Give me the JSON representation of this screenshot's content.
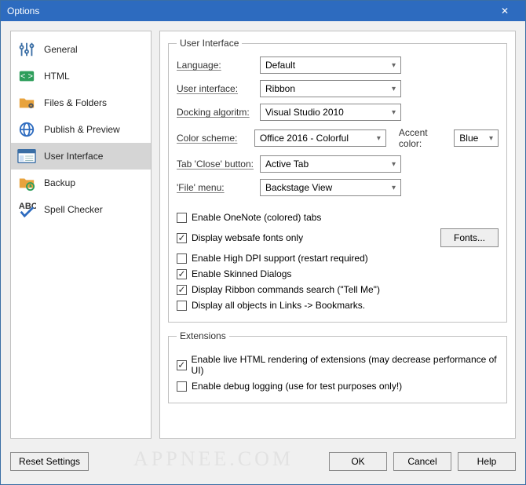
{
  "window": {
    "title": "Options",
    "close_glyph": "✕"
  },
  "sidebar": {
    "items": [
      {
        "label": "General"
      },
      {
        "label": "HTML"
      },
      {
        "label": "Files & Folders"
      },
      {
        "label": "Publish & Preview"
      },
      {
        "label": "User Interface"
      },
      {
        "label": "Backup"
      },
      {
        "label": "Spell Checker"
      }
    ]
  },
  "group_ui": {
    "legend": "User Interface",
    "rows": {
      "language": {
        "label": "Language:",
        "value": "Default"
      },
      "userinterface": {
        "label": "User interface:",
        "value": "Ribbon"
      },
      "docking": {
        "label": "Docking algoritm:",
        "value": "Visual Studio 2010"
      },
      "colorscheme": {
        "label": "Color scheme:",
        "value": "Office 2016 - Colorful",
        "accent_label": "Accent color:",
        "accent_value": "Blue"
      },
      "tabclose": {
        "label": "Tab 'Close' button:",
        "value": "Active Tab"
      },
      "filemenu": {
        "label": "'File' menu:",
        "value": "Backstage View"
      }
    },
    "checks": {
      "onenote": {
        "label": "Enable OneNote (colored) tabs",
        "checked": false
      },
      "websafe": {
        "label": "Display websafe fonts only",
        "checked": true,
        "fonts_btn": "Fonts..."
      },
      "hidpi": {
        "label": "Enable High DPI support (restart required)",
        "checked": false
      },
      "skinned": {
        "label": "Enable Skinned Dialogs",
        "checked": true
      },
      "tellme": {
        "label": "Display Ribbon commands search (\"Tell Me\")",
        "checked": true
      },
      "bookmarks": {
        "label": "Display all objects in Links -> Bookmarks.",
        "checked": false
      }
    }
  },
  "group_ext": {
    "legend": "Extensions",
    "checks": {
      "live": {
        "label": "Enable live HTML rendering of extensions (may decrease performance of UI)",
        "checked": true
      },
      "debug": {
        "label": "Enable debug logging (use for test purposes only!)",
        "checked": false
      }
    }
  },
  "footer": {
    "reset": "Reset Settings",
    "ok": "OK",
    "cancel": "Cancel",
    "help": "Help"
  },
  "watermark": "APPNEE.COM"
}
